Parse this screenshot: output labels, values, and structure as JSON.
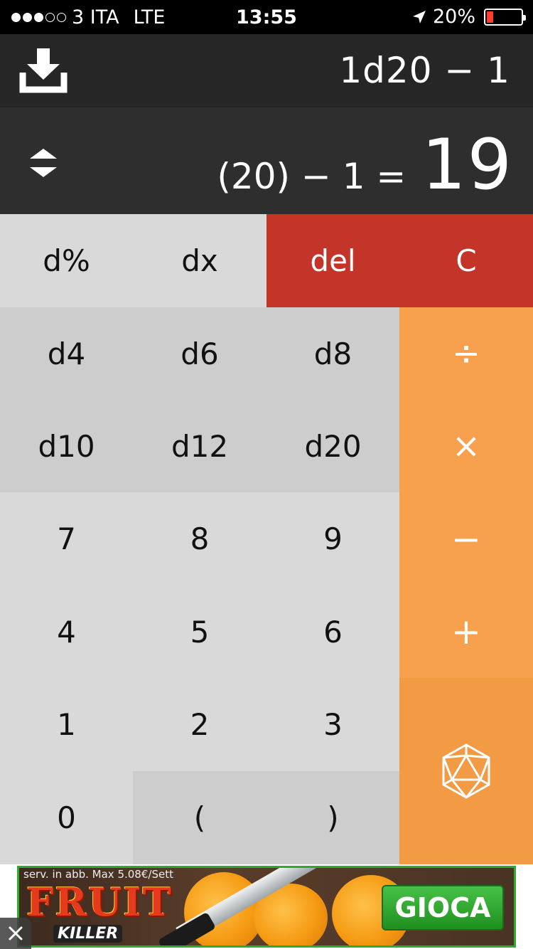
{
  "status_bar": {
    "carrier": "3 ITA",
    "network": "LTE",
    "time": "13:55",
    "battery": "20%",
    "battery_level": 0.2,
    "signal_bars": 3,
    "signal_total": 5
  },
  "expression": {
    "input": "1d20 − 1"
  },
  "result": {
    "calculation": "(20) − 1 =",
    "value": "19"
  },
  "keys": {
    "d_percent": "d%",
    "dx": "dx",
    "del": "del",
    "clear": "C",
    "d4": "d4",
    "d6": "d6",
    "d8": "d8",
    "divide": "÷",
    "d10": "d10",
    "d12": "d12",
    "d20": "d20",
    "multiply": "×",
    "seven": "7",
    "eight": "8",
    "nine": "9",
    "minus": "−",
    "four": "4",
    "five": "5",
    "six": "6",
    "plus": "+",
    "one": "1",
    "two": "2",
    "three": "3",
    "zero": "0",
    "open_paren": "(",
    "close_paren": ")",
    "roll_icon": "d20-die-icon"
  },
  "ad": {
    "disclaimer": "serv. in abb. Max 5.08€/Sett",
    "title": "FRUIT",
    "subtitle": "KILLER",
    "cta": "GIOCA"
  },
  "colors": {
    "red": "#c43529",
    "orange": "#f7a04e",
    "dark": "#262626"
  }
}
